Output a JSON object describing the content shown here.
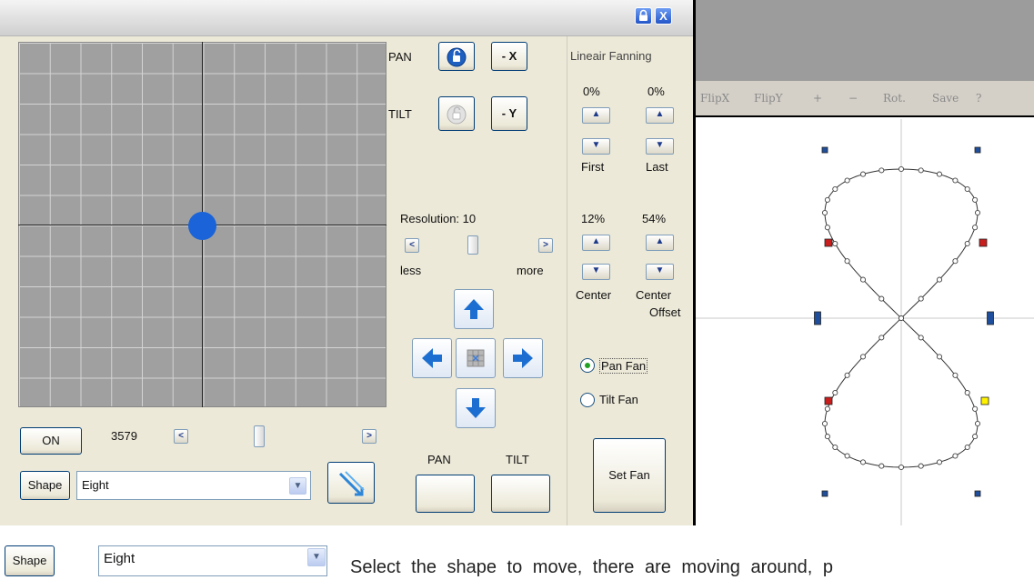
{
  "window": {
    "lock_icon": "lock-icon",
    "close_icon": "close-icon",
    "close_glyph": "X"
  },
  "axes": {
    "pan_label": "PAN",
    "tilt_label": "TILT",
    "invert_x_label": "- X",
    "invert_y_label": "- Y"
  },
  "fanning": {
    "title": "Lineair Fanning",
    "first_value": "0%",
    "last_value": "0%",
    "first_label": "First",
    "last_label": "Last",
    "center_value": "12%",
    "center_offset_value": "54%",
    "center_label": "Center",
    "center_offset_label_1": "Center",
    "center_offset_label_2": "Offset",
    "pan_fan_label": "Pan Fan",
    "tilt_fan_label": "Tilt Fan",
    "pan_fan_selected": true,
    "set_fan_label": "Set Fan"
  },
  "resolution": {
    "label": "Resolution: 10",
    "less_label": "less",
    "more_label": "more"
  },
  "controls": {
    "on_label": "ON",
    "speed_value": "3579",
    "shape_button_label": "Shape",
    "shape_value": "Eight",
    "pan_label": "PAN",
    "tilt_label": "TILT"
  },
  "preview": {
    "menu": [
      "FlipX",
      "FlipY",
      "+",
      "−",
      "Rot.",
      "Save",
      "?"
    ]
  },
  "caption": {
    "shape_button_label": "Shape",
    "shape_value": "Eight",
    "text": "Select the shape to move, there are moving around, p"
  },
  "colors": {
    "accent": "#1a63d8",
    "grid_bg": "#a0a0a0",
    "point_blue": "#1f4f9c",
    "point_red": "#c81e1e",
    "point_yellow": "#fff200"
  }
}
